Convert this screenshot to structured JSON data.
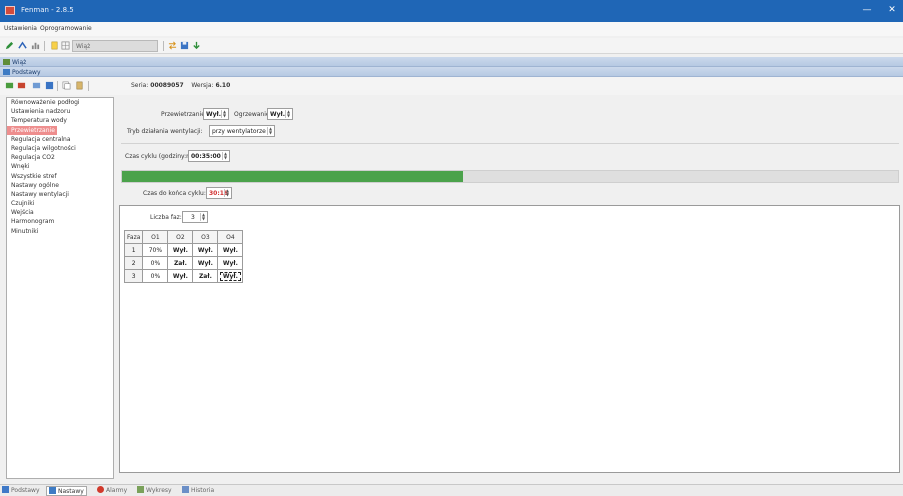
{
  "window": {
    "title": "Fenman - 2.8.5",
    "minimize_glyph": "—",
    "close_glyph": "✕"
  },
  "menu": {
    "items": [
      "Ustawienia",
      "Oprogramowanie"
    ]
  },
  "toolbar": {
    "combo_value": "Wiąż",
    "icons": [
      "pencil-icon",
      "connect-icon",
      "bar-chart-icon",
      "doc-icon",
      "grid-icon",
      "save-icon",
      "download-icon"
    ]
  },
  "panels": {
    "top_label": "Wiąż",
    "second_label": "Podstawy"
  },
  "device_toolbar": {
    "serial_label": "Seria:",
    "serial_value": "00089057",
    "version_label": "Wersja:",
    "version_value": "6.10"
  },
  "sidebar": {
    "items": [
      "Równoważenie podłogi",
      "Ustawienia nadzoru",
      "Temperatura wody",
      "Przewietrzanie",
      "Regulacja centralna",
      "Regulacja wilgotności",
      "Regulacja CO2",
      "Wnęki",
      "Wszystkie stref",
      "Nastawy ogólne",
      "Nastawy wentylacji",
      "Czujniki",
      "Wejścia",
      "Harmonogram",
      "Minutniki"
    ],
    "selected_index": 3
  },
  "settings": {
    "ventilation_label": "Przewietrzanie:",
    "ventilation_value": "Wył.",
    "heating_label": "Ogrzewanie:",
    "heating_value": "Wył.",
    "mode_label": "Tryb działania wentylacji:",
    "mode_value": "przy wentylatorze",
    "interval_label": "Czas cyklu (godziny:minuty):",
    "interval_value": "00:35:00",
    "progress_fraction": 0.44,
    "remaining_label": "Czas do końca cyklu:",
    "remaining_value": "30:16"
  },
  "grid": {
    "stages_label": "Liczba faz:",
    "stages_value": "3",
    "columns": [
      "Faza",
      "O1",
      "O2",
      "O3",
      "O4"
    ],
    "rows": [
      [
        "1",
        "70%",
        "Wył.",
        "Wył.",
        "Wył."
      ],
      [
        "2",
        "0%",
        "Zał.",
        "Wył.",
        "Wył."
      ],
      [
        "3",
        "0%",
        "Wył.",
        "Zał.",
        "Wył."
      ]
    ]
  },
  "statusbar": {
    "tabs": [
      "Podstawy",
      "Nastawy",
      "Alarmy",
      "Wykresy",
      "Historia"
    ],
    "active_index": 1
  }
}
